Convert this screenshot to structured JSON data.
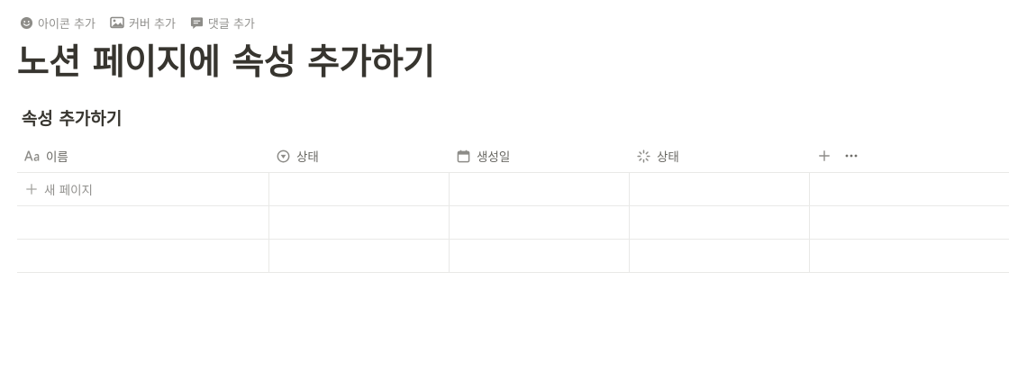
{
  "actions": {
    "add_icon": "아이콘 추가",
    "add_cover": "커버 추가",
    "add_comment": "댓글 추가"
  },
  "page": {
    "title": "노션 페이지에 속성 추가하기"
  },
  "database": {
    "title": "속성 추가하기",
    "columns": [
      {
        "label": "이름",
        "icon": "text-aa-icon"
      },
      {
        "label": "상태",
        "icon": "status-circle-icon"
      },
      {
        "label": "생성일",
        "icon": "calendar-icon"
      },
      {
        "label": "상태",
        "icon": "spinner-icon"
      }
    ],
    "new_page_label": "새 페이지"
  },
  "colors": {
    "text": "#37352f",
    "muted": "#9b9a97",
    "border": "#e9e9e7"
  }
}
